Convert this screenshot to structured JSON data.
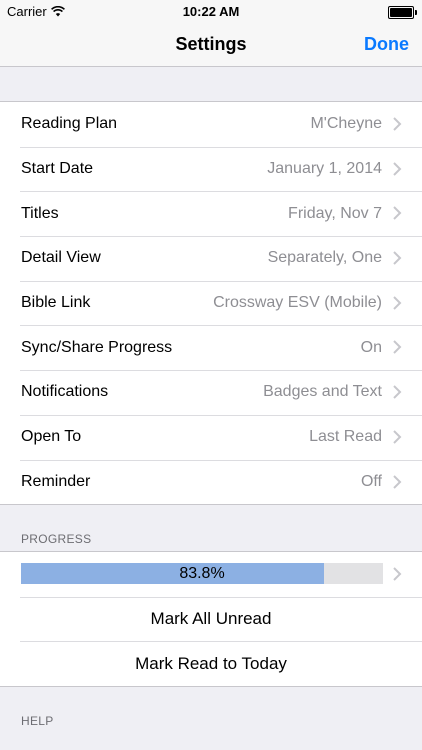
{
  "status_bar": {
    "carrier": "Carrier",
    "time": "10:22 AM"
  },
  "nav": {
    "title": "Settings",
    "done_label": "Done"
  },
  "settings": [
    {
      "label": "Reading Plan",
      "value": "M'Cheyne"
    },
    {
      "label": "Start Date",
      "value": "January 1, 2014"
    },
    {
      "label": "Titles",
      "value": "Friday, Nov 7"
    },
    {
      "label": "Detail View",
      "value": "Separately, One"
    },
    {
      "label": "Bible Link",
      "value": "Crossway ESV (Mobile)"
    },
    {
      "label": "Sync/Share Progress",
      "value": "On"
    },
    {
      "label": "Notifications",
      "value": "Badges and Text"
    },
    {
      "label": "Open To",
      "value": "Last Read"
    },
    {
      "label": "Reminder",
      "value": "Off"
    }
  ],
  "progress": {
    "header": "PROGRESS",
    "percent_label": "83.8%",
    "fraction": 0.838,
    "mark_all_unread": "Mark All Unread",
    "mark_read_today": "Mark Read to Today"
  },
  "help": {
    "header": "HELP"
  },
  "colors": {
    "accent": "#0a7aff",
    "progress_fill": "#8cb0e3",
    "progress_track": "#e2e2e4"
  },
  "icons": {
    "row_disclosure": "chevron-right-icon",
    "wifi": "wifi-icon",
    "battery": "battery-icon"
  }
}
